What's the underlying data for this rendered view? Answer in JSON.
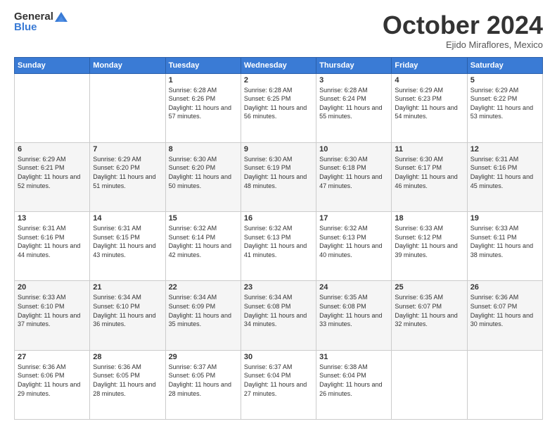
{
  "header": {
    "logo_general": "General",
    "logo_blue": "Blue",
    "month_title": "October 2024",
    "location": "Ejido Miraflores, Mexico"
  },
  "days_of_week": [
    "Sunday",
    "Monday",
    "Tuesday",
    "Wednesday",
    "Thursday",
    "Friday",
    "Saturday"
  ],
  "weeks": [
    [
      {
        "day": "",
        "info": ""
      },
      {
        "day": "",
        "info": ""
      },
      {
        "day": "1",
        "info": "Sunrise: 6:28 AM\nSunset: 6:26 PM\nDaylight: 11 hours and 57 minutes."
      },
      {
        "day": "2",
        "info": "Sunrise: 6:28 AM\nSunset: 6:25 PM\nDaylight: 11 hours and 56 minutes."
      },
      {
        "day": "3",
        "info": "Sunrise: 6:28 AM\nSunset: 6:24 PM\nDaylight: 11 hours and 55 minutes."
      },
      {
        "day": "4",
        "info": "Sunrise: 6:29 AM\nSunset: 6:23 PM\nDaylight: 11 hours and 54 minutes."
      },
      {
        "day": "5",
        "info": "Sunrise: 6:29 AM\nSunset: 6:22 PM\nDaylight: 11 hours and 53 minutes."
      }
    ],
    [
      {
        "day": "6",
        "info": "Sunrise: 6:29 AM\nSunset: 6:21 PM\nDaylight: 11 hours and 52 minutes."
      },
      {
        "day": "7",
        "info": "Sunrise: 6:29 AM\nSunset: 6:20 PM\nDaylight: 11 hours and 51 minutes."
      },
      {
        "day": "8",
        "info": "Sunrise: 6:30 AM\nSunset: 6:20 PM\nDaylight: 11 hours and 50 minutes."
      },
      {
        "day": "9",
        "info": "Sunrise: 6:30 AM\nSunset: 6:19 PM\nDaylight: 11 hours and 48 minutes."
      },
      {
        "day": "10",
        "info": "Sunrise: 6:30 AM\nSunset: 6:18 PM\nDaylight: 11 hours and 47 minutes."
      },
      {
        "day": "11",
        "info": "Sunrise: 6:30 AM\nSunset: 6:17 PM\nDaylight: 11 hours and 46 minutes."
      },
      {
        "day": "12",
        "info": "Sunrise: 6:31 AM\nSunset: 6:16 PM\nDaylight: 11 hours and 45 minutes."
      }
    ],
    [
      {
        "day": "13",
        "info": "Sunrise: 6:31 AM\nSunset: 6:16 PM\nDaylight: 11 hours and 44 minutes."
      },
      {
        "day": "14",
        "info": "Sunrise: 6:31 AM\nSunset: 6:15 PM\nDaylight: 11 hours and 43 minutes."
      },
      {
        "day": "15",
        "info": "Sunrise: 6:32 AM\nSunset: 6:14 PM\nDaylight: 11 hours and 42 minutes."
      },
      {
        "day": "16",
        "info": "Sunrise: 6:32 AM\nSunset: 6:13 PM\nDaylight: 11 hours and 41 minutes."
      },
      {
        "day": "17",
        "info": "Sunrise: 6:32 AM\nSunset: 6:13 PM\nDaylight: 11 hours and 40 minutes."
      },
      {
        "day": "18",
        "info": "Sunrise: 6:33 AM\nSunset: 6:12 PM\nDaylight: 11 hours and 39 minutes."
      },
      {
        "day": "19",
        "info": "Sunrise: 6:33 AM\nSunset: 6:11 PM\nDaylight: 11 hours and 38 minutes."
      }
    ],
    [
      {
        "day": "20",
        "info": "Sunrise: 6:33 AM\nSunset: 6:10 PM\nDaylight: 11 hours and 37 minutes."
      },
      {
        "day": "21",
        "info": "Sunrise: 6:34 AM\nSunset: 6:10 PM\nDaylight: 11 hours and 36 minutes."
      },
      {
        "day": "22",
        "info": "Sunrise: 6:34 AM\nSunset: 6:09 PM\nDaylight: 11 hours and 35 minutes."
      },
      {
        "day": "23",
        "info": "Sunrise: 6:34 AM\nSunset: 6:08 PM\nDaylight: 11 hours and 34 minutes."
      },
      {
        "day": "24",
        "info": "Sunrise: 6:35 AM\nSunset: 6:08 PM\nDaylight: 11 hours and 33 minutes."
      },
      {
        "day": "25",
        "info": "Sunrise: 6:35 AM\nSunset: 6:07 PM\nDaylight: 11 hours and 32 minutes."
      },
      {
        "day": "26",
        "info": "Sunrise: 6:36 AM\nSunset: 6:07 PM\nDaylight: 11 hours and 30 minutes."
      }
    ],
    [
      {
        "day": "27",
        "info": "Sunrise: 6:36 AM\nSunset: 6:06 PM\nDaylight: 11 hours and 29 minutes."
      },
      {
        "day": "28",
        "info": "Sunrise: 6:36 AM\nSunset: 6:05 PM\nDaylight: 11 hours and 28 minutes."
      },
      {
        "day": "29",
        "info": "Sunrise: 6:37 AM\nSunset: 6:05 PM\nDaylight: 11 hours and 28 minutes."
      },
      {
        "day": "30",
        "info": "Sunrise: 6:37 AM\nSunset: 6:04 PM\nDaylight: 11 hours and 27 minutes."
      },
      {
        "day": "31",
        "info": "Sunrise: 6:38 AM\nSunset: 6:04 PM\nDaylight: 11 hours and 26 minutes."
      },
      {
        "day": "",
        "info": ""
      },
      {
        "day": "",
        "info": ""
      }
    ]
  ]
}
